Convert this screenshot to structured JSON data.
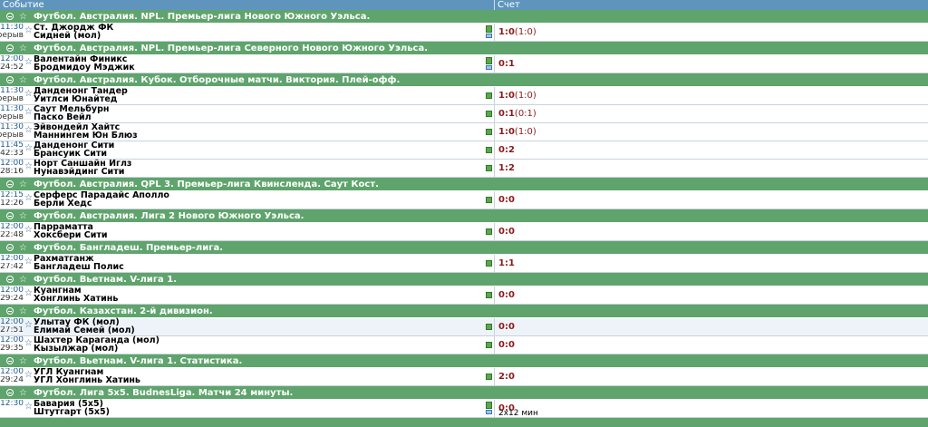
{
  "header": {
    "event_label": "Событие",
    "score_label": "Счет"
  },
  "groups": [
    {
      "title": "Футбол. Австралия. NPL. Премьер-лига Нового Южного Уэльса.",
      "events": [
        {
          "t1": "11:30",
          "t2": "Перерыв",
          "home": "Ст. Джордж ФК",
          "away": "Сидней (мол)",
          "score": "1:0",
          "ht": "(1:0)",
          "extra": ""
        }
      ]
    },
    {
      "title": "Футбол. Австралия. NPL. Премьер-лига Северного Нового Южного Уэльса.",
      "events": [
        {
          "t1": "12:00",
          "t2": "24:52",
          "home": "Валентайн Финикс",
          "away": "Бродмидоу Мэджик",
          "score": "0:1",
          "ht": "",
          "extra": ""
        }
      ]
    },
    {
      "title": "Футбол. Австралия. Кубок. Отборочные матчи. Виктория. Плей-офф.",
      "events": [
        {
          "t1": "11:30",
          "t2": "Перерыв",
          "home": "Данденонг Тандер",
          "away": "Уитлси Юнайтед",
          "score": "1:0",
          "ht": "(1:0)",
          "extra": ""
        },
        {
          "t1": "11:30",
          "t2": "Перерыв",
          "home": "Саут Мельбурн",
          "away": "Паско Вейл",
          "score": "0:1",
          "ht": "(0:1)",
          "extra": ""
        },
        {
          "t1": "11:30",
          "t2": "Перерыв",
          "home": "Эйвондейл Хайтс",
          "away": "Маннингем Юн Блюз",
          "score": "1:0",
          "ht": "(1:0)",
          "extra": ""
        },
        {
          "t1": "11:45",
          "t2": "42:33",
          "home": "Данденонг Сити",
          "away": "Брансуик Сити",
          "score": "0:2",
          "ht": "",
          "extra": ""
        },
        {
          "t1": "12:00",
          "t2": "28:16",
          "home": "Норт Саншайн Иглз",
          "away": "Нунавэйдинг Сити",
          "score": "1:2",
          "ht": "",
          "extra": ""
        }
      ]
    },
    {
      "title": "Футбол. Австралия. QPL 3. Премьер-лига Квинсленда. Саут Кост.",
      "events": [
        {
          "t1": "12:15",
          "t2": "12:26",
          "home": "Серферс Парадайс Аполло",
          "away": "Берли Хедс",
          "score": "0:0",
          "ht": "",
          "extra": ""
        }
      ]
    },
    {
      "title": "Футбол. Австралия. Лига 2 Нового Южного Уэльса.",
      "events": [
        {
          "t1": "12:00",
          "t2": "22:48",
          "home": "Парраматта",
          "away": "Хоксбери Сити",
          "score": "0:0",
          "ht": "",
          "extra": ""
        }
      ]
    },
    {
      "title": "Футбол. Бангладеш. Премьер-лига.",
      "events": [
        {
          "t1": "12:00",
          "t2": "27:42",
          "home": "Рахматганж",
          "away": "Бангладеш Полис",
          "score": "1:1",
          "ht": "",
          "extra": ""
        }
      ]
    },
    {
      "title": "Футбол. Вьетнам. V-лига 1.",
      "events": [
        {
          "t1": "12:00",
          "t2": "29:24",
          "home": "Куангнам",
          "away": "Хонглинь Хатинь",
          "score": "0:0",
          "ht": "",
          "extra": ""
        }
      ]
    },
    {
      "title": "Футбол. Казахстан. 2-й дивизион.",
      "events": [
        {
          "t1": "12:00",
          "t2": "27:51",
          "home": "Улытау ФК (мол)",
          "away": "Елимай Семей (мол)",
          "score": "0:0",
          "ht": "",
          "extra": ""
        },
        {
          "t1": "12:00",
          "t2": "29:35",
          "home": "Шахтер Караганда (мол)",
          "away": "Кызылжар (мол)",
          "score": "0:0",
          "ht": "",
          "extra": ""
        }
      ]
    },
    {
      "title": "Футбол. Вьетнам. V-лига 1. Статистика.",
      "events": [
        {
          "t1": "12:00",
          "t2": "29:24",
          "home": "УГЛ Куангнам",
          "away": "УГЛ Хонглинь Хатинь",
          "score": "2:0",
          "ht": "",
          "extra": ""
        }
      ]
    },
    {
      "title": "Футбол. Лига 5х5. BudnesLiga. Матчи 24 минуты.",
      "events": [
        {
          "t1": "12:30",
          "t2": "",
          "home": "Бавария (5х5)",
          "away": "Штутгарт (5х5)",
          "score": "0:0",
          "ht": "",
          "extra": "2х12 мин"
        }
      ]
    }
  ],
  "icons": {
    "toggle": "collapse-circle-icon",
    "favorite": "star-icon",
    "stats": "stats-icon",
    "tv": "tv-icon"
  },
  "colors": {
    "header": "#5f95bd",
    "league": "#5fa46c",
    "score": "#8b1a1a"
  }
}
